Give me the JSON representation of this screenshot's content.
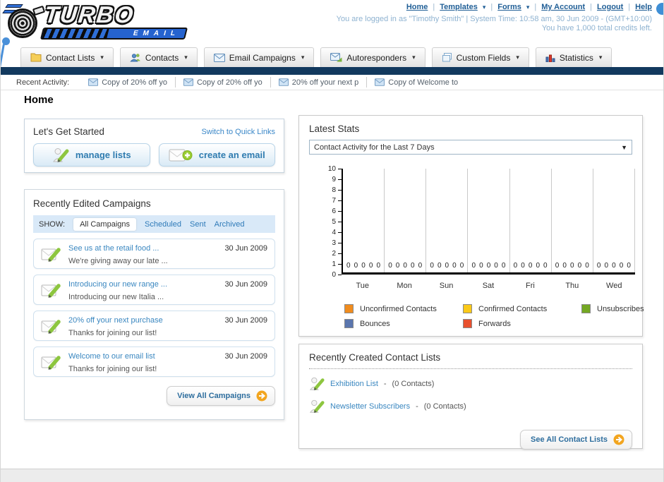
{
  "brand": {
    "name": "TURBO",
    "sub": "EMAIL"
  },
  "utility_nav": {
    "items": [
      {
        "label": "Home",
        "has_dropdown": false
      },
      {
        "label": "Templates",
        "has_dropdown": true
      },
      {
        "label": "Forms",
        "has_dropdown": true
      },
      {
        "label": "My Account",
        "has_dropdown": false
      },
      {
        "label": "Logout",
        "has_dropdown": false
      },
      {
        "label": "Help",
        "has_dropdown": false
      }
    ],
    "separator": "|"
  },
  "session": {
    "login_text": "You are logged in as \"Timothy Smith\" | System Time: 10:58 am, 30 Jun 2009 - (GMT+10:00)",
    "credits_text": "You have 1,000 total credits left."
  },
  "nav_tabs": [
    {
      "label": "Contact Lists"
    },
    {
      "label": "Contacts"
    },
    {
      "label": "Email Campaigns"
    },
    {
      "label": "Autoresponders"
    },
    {
      "label": "Custom Fields"
    },
    {
      "label": "Statistics"
    }
  ],
  "recent_activity": {
    "label": "Recent Activity:",
    "items": [
      "Copy of 20% off yo",
      "Copy of 20% off yo",
      "20% off your next p",
      "Copy of Welcome to"
    ]
  },
  "page": {
    "title": "Home"
  },
  "get_started": {
    "title": "Let's Get Started",
    "switch_link": "Switch to Quick Links",
    "buttons": [
      {
        "label": "manage lists"
      },
      {
        "label": "create an email"
      }
    ]
  },
  "campaigns": {
    "title": "Recently Edited Campaigns",
    "show_label": "SHOW:",
    "filters": [
      {
        "label": "All Campaigns",
        "active": true
      },
      {
        "label": "Scheduled",
        "active": false
      },
      {
        "label": "Sent",
        "active": false
      },
      {
        "label": "Archived",
        "active": false
      }
    ],
    "rows": [
      {
        "title": "See us at the retail food ...",
        "subtitle": "We're giving away our late ...",
        "date": "30 Jun 2009"
      },
      {
        "title": "Introducing our new range ...",
        "subtitle": "Introducing our new Italia ...",
        "date": "30 Jun 2009"
      },
      {
        "title": "20% off your next purchase",
        "subtitle": "Thanks for joining our list!",
        "date": "30 Jun 2009"
      },
      {
        "title": "Welcome to our email list",
        "subtitle": "Thanks for joining our list!",
        "date": "30 Jun 2009"
      }
    ],
    "view_all_label": "View All Campaigns"
  },
  "stats": {
    "title": "Latest Stats",
    "selected_option": "Contact Activity for the Last 7 Days"
  },
  "chart_data": {
    "type": "bar",
    "title": "Contact Activity for the Last 7 Days",
    "categories": [
      "Tue",
      "Mon",
      "Sun",
      "Sat",
      "Fri",
      "Thu",
      "Wed"
    ],
    "series": [
      {
        "name": "Unconfirmed Contacts",
        "color": "#F08C1E",
        "values": [
          0,
          0,
          0,
          0,
          0,
          0,
          0
        ]
      },
      {
        "name": "Confirmed Contacts",
        "color": "#FBC918",
        "values": [
          0,
          0,
          0,
          0,
          0,
          0,
          0
        ]
      },
      {
        "name": "Unsubscribes",
        "color": "#74A823",
        "values": [
          0,
          0,
          0,
          0,
          0,
          0,
          0
        ]
      },
      {
        "name": "Bounces",
        "color": "#5B76AE",
        "values": [
          0,
          0,
          0,
          0,
          0,
          0,
          0
        ]
      },
      {
        "name": "Forwards",
        "color": "#E8502E",
        "values": [
          0,
          0,
          0,
          0,
          0,
          0,
          0
        ]
      }
    ],
    "ylim": [
      0,
      10
    ],
    "ytick_step": 1,
    "value_labels_shown": true,
    "grid": "vertical-only",
    "legend_position": "bottom"
  },
  "contact_lists": {
    "title": "Recently Created Contact Lists",
    "separator": "-",
    "items": [
      {
        "name": "Exhibition List",
        "count": "(0 Contacts)"
      },
      {
        "name": "Newsletter Subscribers",
        "count": "(0 Contacts)"
      }
    ],
    "see_all_label": "See All Contact Lists"
  }
}
